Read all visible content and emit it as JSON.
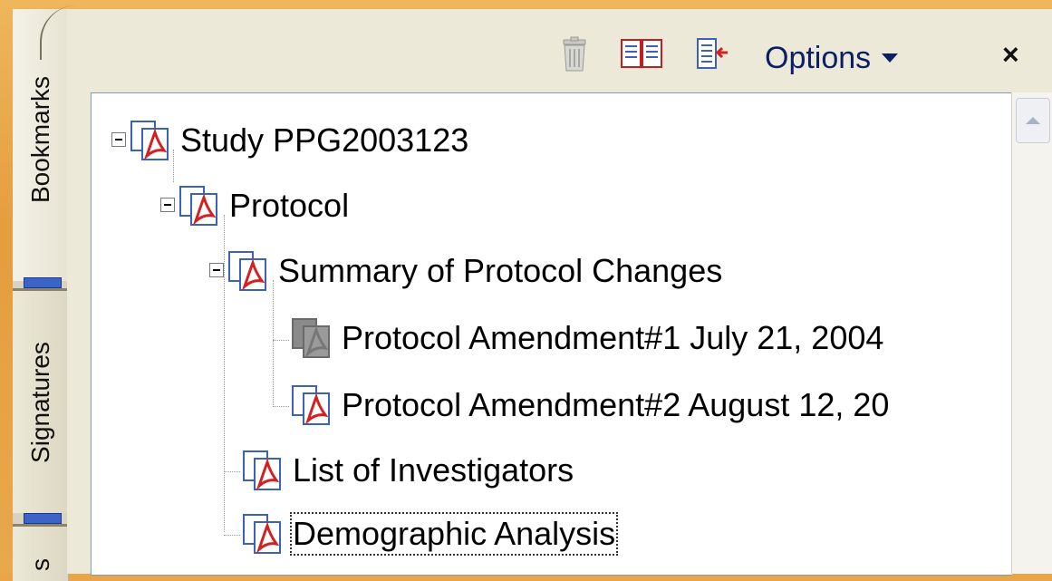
{
  "side_tabs": {
    "bookmarks": "Bookmarks",
    "signatures": "Signatures",
    "next_tab_partial": "s"
  },
  "toolbar": {
    "options_label": "Options",
    "close_label": "×",
    "icons": [
      "trash-icon",
      "book-icon",
      "page-arrow-icon",
      "chevron-down-icon",
      "close-icon"
    ]
  },
  "tree": {
    "items": [
      {
        "label": "Study PPG2003123",
        "level": 0,
        "expanded": true,
        "icon": "pdf-bookmark-icon"
      },
      {
        "label": "Protocol",
        "level": 1,
        "expanded": true,
        "icon": "pdf-bookmark-icon"
      },
      {
        "label": "Summary of Protocol Changes",
        "level": 2,
        "expanded": true,
        "icon": "pdf-bookmark-icon"
      },
      {
        "label": "Protocol Amendment#1 July 21, 2004",
        "level": 3,
        "icon": "gray-bookmark-icon"
      },
      {
        "label": "Protocol Amendment#2 August 12, 20",
        "level": 3,
        "icon": "pdf-bookmark-icon"
      },
      {
        "label": "List of Investigators",
        "level": 2,
        "icon": "pdf-bookmark-icon"
      },
      {
        "label": "Demographic Analysis",
        "level": 2,
        "icon": "pdf-bookmark-icon",
        "focused": true
      }
    ]
  },
  "colors": {
    "frame": "#eaa548",
    "panel": "#ece9d8",
    "tab_grip": "#3c63c8",
    "pdf_red": "#d42020",
    "doc_blue": "#3a62b8"
  }
}
